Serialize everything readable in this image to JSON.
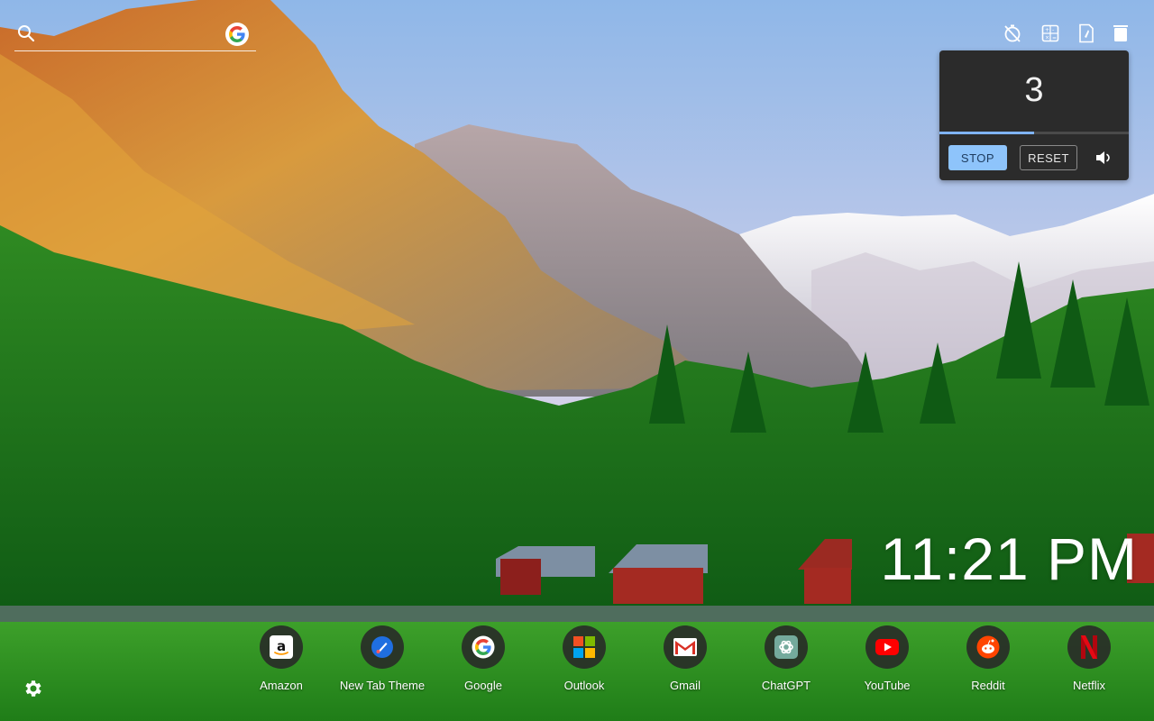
{
  "search": {
    "placeholder": "",
    "engine_icon": "google-icon"
  },
  "tools": [
    "stopwatch-off-icon",
    "calculator-icon",
    "notepad-icon",
    "trash-icon"
  ],
  "timer": {
    "count": "3",
    "progress_fraction": 0.5,
    "stop_label": "STOP",
    "reset_label": "RESET",
    "sound_icon": "speaker-icon"
  },
  "clock": {
    "time": "11:21 PM"
  },
  "shortcuts": [
    {
      "label": "Amazon",
      "icon": "amazon-icon"
    },
    {
      "label": "New Tab Theme",
      "icon": "new-tab-theme-icon"
    },
    {
      "label": "Google",
      "icon": "google-icon"
    },
    {
      "label": "Outlook",
      "icon": "microsoft-icon"
    },
    {
      "label": "Gmail",
      "icon": "gmail-icon"
    },
    {
      "label": "ChatGPT",
      "icon": "chatgpt-icon"
    },
    {
      "label": "YouTube",
      "icon": "youtube-icon"
    },
    {
      "label": "Reddit",
      "icon": "reddit-icon"
    },
    {
      "label": "Netflix",
      "icon": "netflix-icon"
    }
  ],
  "settings": {
    "icon": "gear-icon"
  },
  "colors": {
    "timer_bg": "#2b2b2b",
    "stop_button": "#8ec4fb",
    "progress": "#7fb3f5"
  }
}
